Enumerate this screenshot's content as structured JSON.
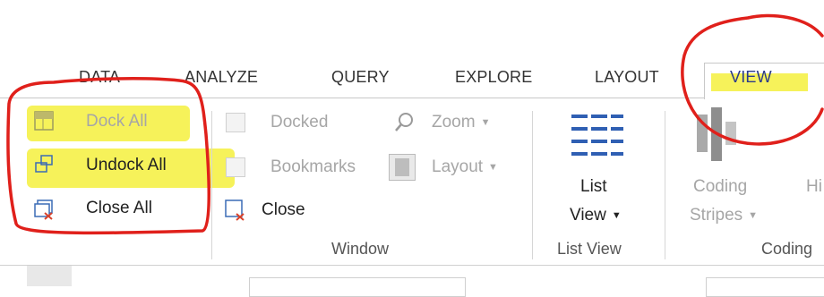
{
  "tabs": [
    {
      "label": "DATA"
    },
    {
      "label": "ANALYZE"
    },
    {
      "label": "QUERY"
    },
    {
      "label": "EXPLORE"
    },
    {
      "label": "LAYOUT"
    },
    {
      "label": "VIEW",
      "active": true
    }
  ],
  "window_group": {
    "dock_all": "Dock All",
    "undock_all": "Undock All",
    "close_all": "Close All",
    "docked": "Docked",
    "bookmarks": "Bookmarks",
    "close": "Close",
    "zoom": "Zoom",
    "layout": "Layout",
    "label": "Window"
  },
  "list_view_group": {
    "button_line1": "List",
    "button_line2": "View",
    "label": "List View"
  },
  "coding_group": {
    "stripes_line1": "Coding",
    "stripes_line2": "Stripes",
    "next_partial": "Hi",
    "label": "Coding"
  },
  "colors": {
    "highlight": "#f6f25a",
    "annotation": "#e0201b",
    "disabled_text": "#a6a6a6"
  }
}
